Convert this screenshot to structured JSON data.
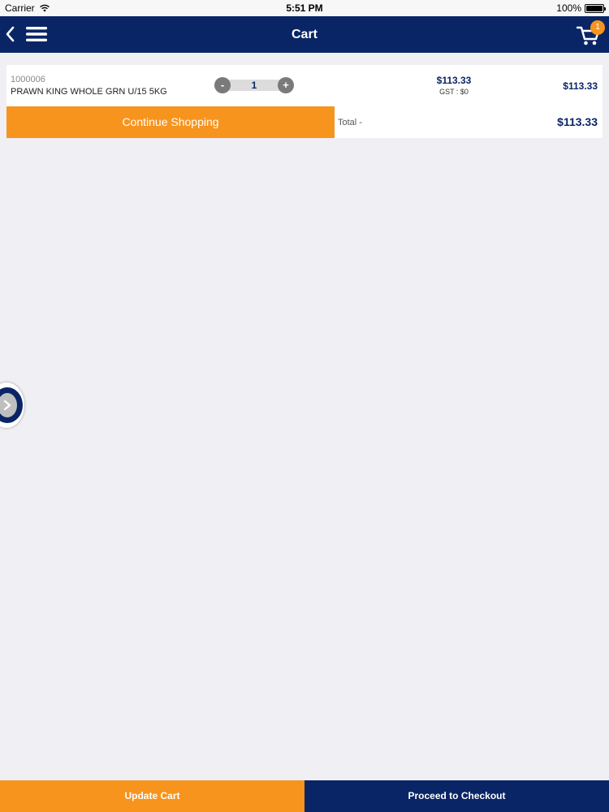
{
  "status_bar": {
    "carrier": "Carrier",
    "time": "5:51 PM",
    "battery": "100%"
  },
  "nav": {
    "title": "Cart",
    "cart_count": "1",
    "icons": [
      "back-chevron-icon",
      "hamburger-menu-icon",
      "cart-icon"
    ]
  },
  "cart": {
    "items": [
      {
        "code": "1000006",
        "name": "PRAWN KING WHOLE GRN U/15 5KG",
        "quantity": "1",
        "unit_price": "$113.33",
        "gst": "GST : $0",
        "line_total": "$113.33"
      }
    ],
    "continue_label": "Continue Shopping",
    "total_label": "Total -",
    "total_value": "$113.33"
  },
  "footer": {
    "update_label": "Update Cart",
    "checkout_label": "Proceed to Checkout"
  },
  "colors": {
    "navy": "#0a2566",
    "orange": "#f7941d",
    "background": "#efeff4"
  }
}
